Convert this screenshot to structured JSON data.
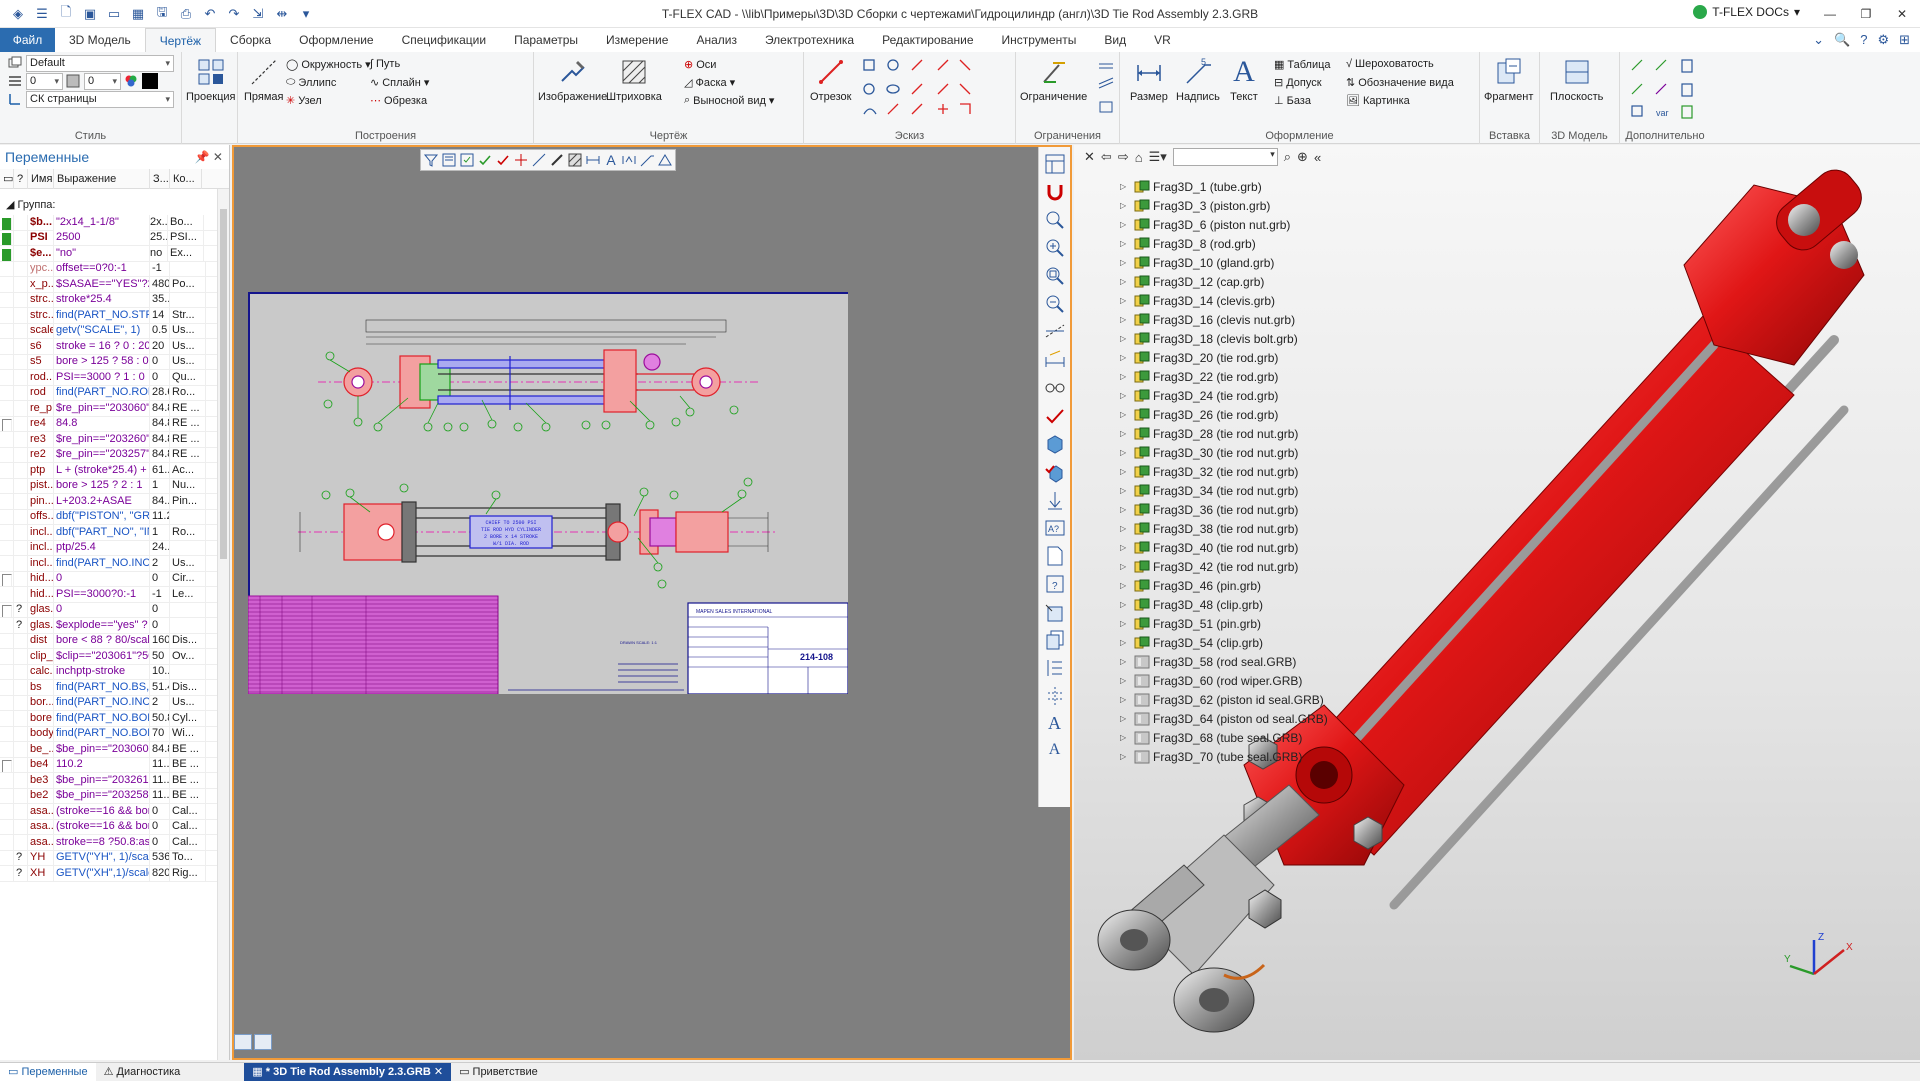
{
  "app": {
    "title": "T-FLEX CAD - \\\\lib\\Примеры\\3D\\3D Сборки с чертежами\\Гидроцилиндр (англ)\\3D Tie Rod Assembly 2.3.GRB",
    "docs_label": "T-FLEX DOCs"
  },
  "ribbon_tabs": [
    "Файл",
    "3D Модель",
    "Чертёж",
    "Сборка",
    "Оформление",
    "Спецификации",
    "Параметры",
    "Измерение",
    "Анализ",
    "Электротехника",
    "Редактирование",
    "Инструменты",
    "Вид",
    "VR"
  ],
  "style_group": {
    "layer_value": "Default",
    "field1_value": "0",
    "field2_value": "0",
    "cs_value": "СК страницы",
    "label": "Стиль"
  },
  "groups": {
    "projection": "Проекция",
    "line": "Прямая",
    "circle": "Окружность",
    "ellipse": "Эллипс",
    "node": "Узел",
    "path": "Путь",
    "spline": "Сплайн",
    "trim": "Обрезка",
    "constructions": "Построения",
    "image": "Изображение",
    "hatch": "Штриховка",
    "axes": "Оси",
    "chamfer": "Фаска",
    "leader": "Выносной вид",
    "drawing": "Чертёж",
    "segment": "Отрезок",
    "sketch": "Эскиз",
    "constraint": "Ограничение",
    "constraints": "Ограничения",
    "dimension": "Размер",
    "inscription": "Надпись",
    "text": "Текст",
    "table": "Таблица",
    "tolerance": "Допуск",
    "base": "База",
    "roughness": "Шероховатость",
    "view_mark": "Обозначение вида",
    "picture": "Картинка",
    "formatting": "Оформление",
    "fragment": "Фрагмент",
    "insert": "Вставка",
    "plane": "Плоскость",
    "model3d": "3D Модель",
    "extra": "Дополнительно"
  },
  "variables": {
    "title": "Переменные",
    "columns": [
      "?",
      "Имя",
      "Выражение",
      "З...",
      "Ко..."
    ],
    "group_label": "Группа:",
    "rows": [
      {
        "flag": "green",
        "q": "",
        "name": "$b...",
        "expr": "\"2x14_1-1/8\"",
        "val": "2x...",
        "com": "Bo...",
        "bold": true,
        "str": true,
        "combo": true
      },
      {
        "flag": "green",
        "q": "",
        "name": "PSI",
        "expr": "2500",
        "val": "25...",
        "com": "PSI...",
        "bold": true,
        "str": true,
        "combo": true
      },
      {
        "flag": "green",
        "q": "",
        "name": "$e...",
        "expr": "\"no\"",
        "val": "no",
        "com": "Ex...",
        "bold": true,
        "str": true,
        "combo": true
      },
      {
        "flag": "",
        "q": "",
        "name": "ypc...",
        "expr": "offset==0?0:-1",
        "val": "-1",
        "com": "",
        "dim": true
      },
      {
        "flag": "",
        "q": "",
        "name": "x_p...",
        "expr": "$SASAE==\"YES\"?220/...",
        "val": "480",
        "com": "Po..."
      },
      {
        "flag": "",
        "q": "",
        "name": "strc...",
        "expr": "stroke*25.4",
        "val": "35...",
        "com": ""
      },
      {
        "flag": "",
        "q": "",
        "name": "strc...",
        "expr": "find(PART_NO.STRC...",
        "val": "14",
        "com": "Str...",
        "fn": true
      },
      {
        "flag": "",
        "q": "",
        "name": "scale",
        "expr": "getv(\"SCALE\", 1)",
        "val": "0.5",
        "com": "Us...",
        "fn": true
      },
      {
        "flag": "",
        "q": "",
        "name": "s6",
        "expr": "stroke = 16 ? 0 : 20",
        "val": "20",
        "com": "Us..."
      },
      {
        "flag": "",
        "q": "",
        "name": "s5",
        "expr": "bore > 125 ? 58 : 0",
        "val": "0",
        "com": "Us..."
      },
      {
        "flag": "",
        "q": "",
        "name": "rod...",
        "expr": "PSI==3000 ? 1 : 0",
        "val": "0",
        "com": "Qu..."
      },
      {
        "flag": "",
        "q": "",
        "name": "rod",
        "expr": "find(PART_NO.ROD...",
        "val": "28.6",
        "com": "Ro...",
        "fn": true
      },
      {
        "flag": "",
        "q": "",
        "name": "re_p...",
        "expr": "$re_pin==\"203060\"?...",
        "val": "84.8",
        "com": "RE ..."
      },
      {
        "flag": "white",
        "q": "",
        "name": "re4",
        "expr": "84.8",
        "val": "84.8",
        "com": "RE ..."
      },
      {
        "flag": "",
        "q": "",
        "name": "re3",
        "expr": "$re_pin==\"203260\"?...",
        "val": "84.8",
        "com": "RE ..."
      },
      {
        "flag": "",
        "q": "",
        "name": "re2",
        "expr": "$re_pin==\"203257\"?...",
        "val": "84.8",
        "com": "RE ..."
      },
      {
        "flag": "",
        "q": "",
        "name": "ptp",
        "expr": "L + (stroke*25.4) + A...",
        "val": "61...",
        "com": "Ac..."
      },
      {
        "flag": "",
        "q": "",
        "name": "pist...",
        "expr": "bore > 125 ? 2 : 1",
        "val": "1",
        "com": "Nu..."
      },
      {
        "flag": "",
        "q": "",
        "name": "pin...",
        "expr": "L+203.2+ASAE",
        "val": "84...",
        "com": "Pin..."
      },
      {
        "flag": "",
        "q": "",
        "name": "offs...",
        "expr": "dbf(\"PISTON\", \"GRV...",
        "val": "11.2",
        "com": "",
        "fn": true
      },
      {
        "flag": "",
        "q": "",
        "name": "incl...",
        "expr": "dbf(\"PART_NO\", \"IN...",
        "val": "1",
        "com": "Ro...",
        "fn": true
      },
      {
        "flag": "",
        "q": "",
        "name": "incl...",
        "expr": "ptp/25.4",
        "val": "24...",
        "com": ""
      },
      {
        "flag": "",
        "q": "",
        "name": "incl...",
        "expr": "find(PART_NO.INCH...",
        "val": "2",
        "com": "Us...",
        "fn": true
      },
      {
        "flag": "white",
        "q": "",
        "name": "hid...",
        "expr": "0",
        "val": "0",
        "com": "Cir..."
      },
      {
        "flag": "",
        "q": "",
        "name": "hid...",
        "expr": "PSI==3000?0:-1",
        "val": "-1",
        "com": "Le..."
      },
      {
        "flag": "white",
        "q": "?",
        "name": "glas...",
        "expr": "0",
        "val": "0",
        "com": ""
      },
      {
        "flag": "",
        "q": "?",
        "name": "glas...",
        "expr": "$explode==\"yes\" ? -...",
        "val": "0",
        "com": ""
      },
      {
        "flag": "",
        "q": "",
        "name": "dist",
        "expr": "bore < 88 ? 80/scale...",
        "val": "160",
        "com": "Dis..."
      },
      {
        "flag": "",
        "q": "",
        "name": "clip_l",
        "expr": "$clip==\"203061\"?50...",
        "val": "50",
        "com": "Ov..."
      },
      {
        "flag": "",
        "q": "",
        "name": "calc...",
        "expr": "inchptp-stroke",
        "val": "10...",
        "com": ""
      },
      {
        "flag": "",
        "q": "",
        "name": "bs",
        "expr": "find(PART_NO.BS, P...",
        "val": "51.4",
        "com": "Dis...",
        "fn": true
      },
      {
        "flag": "",
        "q": "",
        "name": "bor...",
        "expr": "find(PART_NO.INCH...",
        "val": "2",
        "com": "Us...",
        "fn": true
      },
      {
        "flag": "",
        "q": "",
        "name": "bore",
        "expr": "find(PART_NO.BORE,...",
        "val": "50.8",
        "com": "Cyl...",
        "fn": true
      },
      {
        "flag": "",
        "q": "",
        "name": "body",
        "expr": "find(PART_NO.BODY,...",
        "val": "70",
        "com": "Wi...",
        "fn": true
      },
      {
        "flag": "",
        "q": "",
        "name": "be_...",
        "expr": "$be_pin==\"203060\"?...",
        "val": "84.8",
        "com": "BE ..."
      },
      {
        "flag": "white",
        "q": "",
        "name": "be4",
        "expr": "110.2",
        "val": "11...",
        "com": "BE ..."
      },
      {
        "flag": "",
        "q": "",
        "name": "be3",
        "expr": "$be_pin==\"203261\"?...",
        "val": "11...",
        "com": "BE ..."
      },
      {
        "flag": "",
        "q": "",
        "name": "be2",
        "expr": "$be_pin==\"203258\"?...",
        "val": "11...",
        "com": "BE ..."
      },
      {
        "flag": "",
        "q": "",
        "name": "asa...",
        "expr": "(stroke==16 && bore...",
        "val": "0",
        "com": "Cal..."
      },
      {
        "flag": "",
        "q": "",
        "name": "asa...",
        "expr": "(stroke==16 && bore...",
        "val": "0",
        "com": "Cal..."
      },
      {
        "flag": "",
        "q": "",
        "name": "asa...",
        "expr": "stroke==8 ?50.8:asa...",
        "val": "0",
        "com": "Cal..."
      },
      {
        "flag": "",
        "q": "?",
        "name": "YH",
        "expr": "GETV(\"YH\", 1)/scale",
        "val": "536",
        "com": "To...",
        "fn": true
      },
      {
        "flag": "",
        "q": "?",
        "name": "XH",
        "expr": "GETV(\"XH\",1)/scale",
        "val": "820",
        "com": "Rig...",
        "fn": true
      }
    ]
  },
  "bottom_tabs": {
    "variables": "Переменные",
    "diagnostics": "Диагностика",
    "doc": "* 3D Tie Rod Assembly 2.3.GRB",
    "welcome": "Приветствие"
  },
  "drawing": {
    "note_lines": [
      "CHIEF TO 2500 PSI",
      "TIE ROD HYD CYLINDER",
      "2 BORE x 14 STROKE",
      "W/1 DIA. ROD"
    ],
    "company": "MAPEN SALES INTERNATIONAL",
    "part_no": "214-108",
    "scale_note": "DRAWN SCALE: 1:1"
  },
  "tree": [
    "Frag3D_1 (tube.grb)",
    "Frag3D_3 (piston.grb)",
    "Frag3D_6 (piston nut.grb)",
    "Frag3D_8 (rod.grb)",
    "Frag3D_10 (gland.grb)",
    "Frag3D_12 (cap.grb)",
    "Frag3D_14 (clevis.grb)",
    "Frag3D_16 (clevis nut.grb)",
    "Frag3D_18 (clevis bolt.grb)",
    "Frag3D_20 (tie rod.grb)",
    "Frag3D_22 (tie rod.grb)",
    "Frag3D_24 (tie rod.grb)",
    "Frag3D_26 (tie rod.grb)",
    "Frag3D_28 (tie rod nut.grb)",
    "Frag3D_30 (tie rod nut.grb)",
    "Frag3D_32 (tie rod nut.grb)",
    "Frag3D_34 (tie rod nut.grb)",
    "Frag3D_36 (tie rod nut.grb)",
    "Frag3D_38 (tie rod nut.grb)",
    "Frag3D_40 (tie rod nut.grb)",
    "Frag3D_42 (tie rod nut.grb)",
    "Frag3D_46 (pin.grb)",
    "Frag3D_48 (clip.grb)",
    "Frag3D_51 (pin.grb)",
    "Frag3D_54 (clip.grb)",
    "Frag3D_58 (rod seal.GRB)",
    "Frag3D_60 (rod wiper.GRB)",
    "Frag3D_62 (piston id seal.GRB)",
    "Frag3D_64 (piston od seal.GRB)",
    "Frag3D_68 (tube seal.GRB)",
    "Frag3D_70 (tube seal.GRB)"
  ],
  "axes_labels": {
    "x": "X",
    "y": "Y",
    "z": "Z"
  },
  "colors": {
    "accent": "#2b6cb0",
    "cylinder": "#d61a1a",
    "drawing_red": "#e0202a",
    "drawing_green": "#16a016",
    "drawing_purple": "#9b0d9b"
  }
}
